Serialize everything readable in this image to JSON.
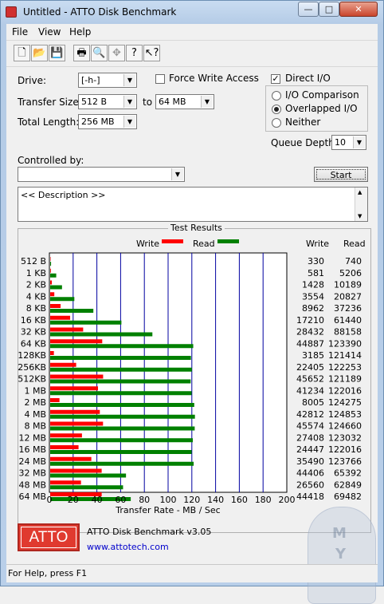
{
  "window": {
    "title": "Untitled - ATTO Disk Benchmark",
    "minimize": "—",
    "restore": "□",
    "close": "✕"
  },
  "menu": [
    "File",
    "View",
    "Help"
  ],
  "toolbar_icons": [
    "new-icon",
    "open-icon",
    "save-icon",
    "print-icon",
    "print-preview-icon",
    "move-icon",
    "help-icon",
    "context-help-icon"
  ],
  "form": {
    "drive_label": "Drive:",
    "drive_value": "[-h-]",
    "force_write_label": "Force Write Access",
    "force_write_checked": false,
    "direct_io_label": "Direct I/O",
    "direct_io_checked": true,
    "transfer_size_label": "Transfer Size:",
    "transfer_from": "512 B",
    "to_label": "to",
    "transfer_to": "64 MB",
    "total_length_label": "Total Length:",
    "total_length": "256 MB",
    "io_options": [
      {
        "label": "I/O Comparison",
        "selected": false
      },
      {
        "label": "Overlapped I/O",
        "selected": true
      },
      {
        "label": "Neither",
        "selected": false
      }
    ],
    "queue_depth_label": "Queue Depth:",
    "queue_depth": "10",
    "controlled_by_label": "Controlled by:",
    "controlled_by_value": "",
    "start_button": "Start",
    "description": "<< Description >>"
  },
  "results": {
    "title": "Test Results",
    "legend_write": "Write",
    "legend_read": "Read",
    "col_write": "Write",
    "col_read": "Read",
    "xlabel": "Transfer Rate - MB / Sec"
  },
  "chart_data": {
    "type": "bar",
    "orientation": "horizontal",
    "xlabel": "Transfer Rate - MB / Sec",
    "xlim": [
      0,
      200
    ],
    "xticks": [
      0,
      20,
      40,
      60,
      80,
      100,
      120,
      140,
      160,
      180,
      200
    ],
    "categories": [
      "512 B",
      "1 KB",
      "2 KB",
      "4 KB",
      "8 KB",
      "16 KB",
      "32 KB",
      "64 KB",
      "128KB",
      "256KB",
      "512KB",
      "1 MB",
      "2 MB",
      "4 MB",
      "8 MB",
      "12 MB",
      "16 MB",
      "24 MB",
      "32 MB",
      "48 MB",
      "64 MB"
    ],
    "series": [
      {
        "name": "Write",
        "color": "#ff0000",
        "values": [
          330,
          581,
          1428,
          3554,
          8962,
          17210,
          28432,
          44887,
          3185,
          22405,
          45652,
          41234,
          8005,
          42812,
          45574,
          27408,
          24447,
          35490,
          44406,
          26560,
          44418
        ]
      },
      {
        "name": "Read",
        "color": "#008000",
        "values": [
          740,
          5206,
          10189,
          20827,
          37236,
          61440,
          88158,
          123390,
          121414,
          122253,
          121189,
          122016,
          124275,
          124853,
          124660,
          123032,
          122016,
          123766,
          65392,
          62849,
          69482
        ]
      }
    ],
    "value_unit_divisor": 1024,
    "grid": true,
    "legend": "top"
  },
  "footer": {
    "product": "ATTO Disk Benchmark v3.05",
    "url": "www.attotech.com",
    "logo_text": "ATTO"
  },
  "status": "For Help, press F1",
  "colors": {
    "write": "#ff0000",
    "read": "#008000",
    "grid": "#0000a0",
    "logo": "#e03a2f"
  }
}
